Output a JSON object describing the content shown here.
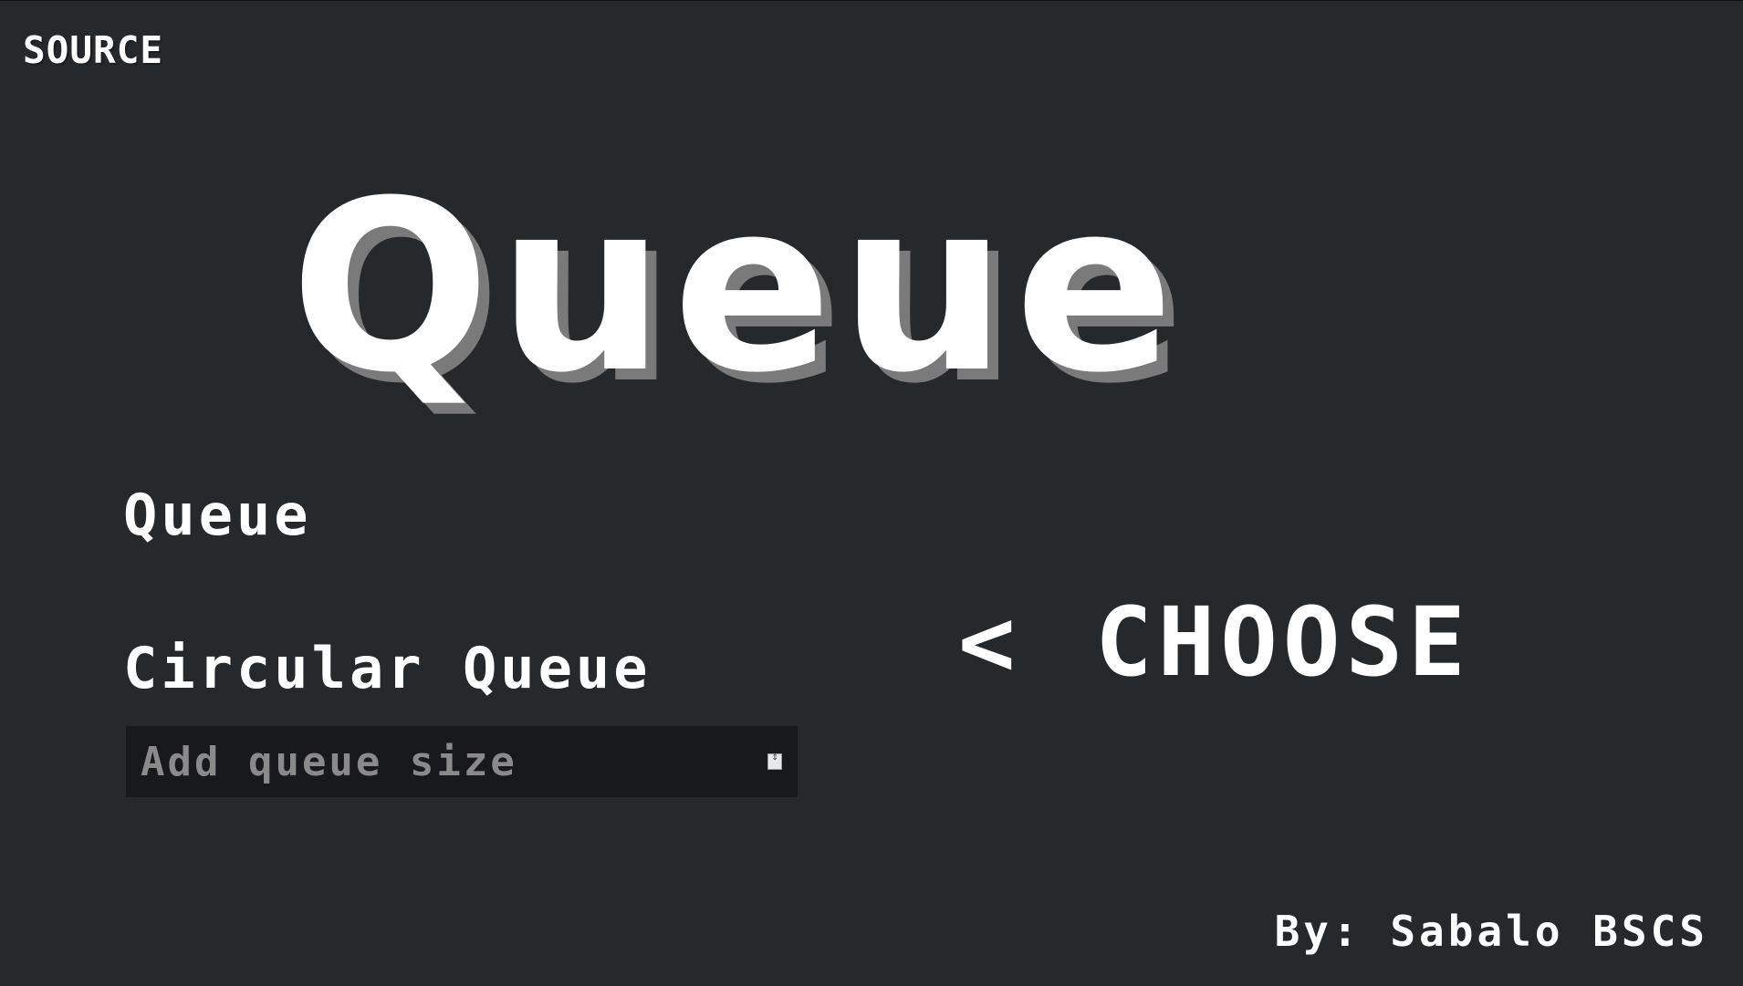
{
  "header": {
    "source_label": "SOURCE"
  },
  "hero": {
    "title": "Queue"
  },
  "menu": {
    "options": [
      {
        "label": "Queue"
      },
      {
        "label": "Circular Queue"
      }
    ],
    "size_input": {
      "placeholder": "Add queue size",
      "value": ""
    }
  },
  "choose": {
    "arrow": "<",
    "label": "CHOOSE"
  },
  "footer": {
    "credit": "By: Sabalo BSCS"
  },
  "colors": {
    "background": "#26292c",
    "text": "#ffffff",
    "title_shadow": "#7a7a7a",
    "input_background": "#17191c",
    "placeholder": "#8a8a8a"
  },
  "icons": {
    "spinner": "number-spinner-icon"
  }
}
